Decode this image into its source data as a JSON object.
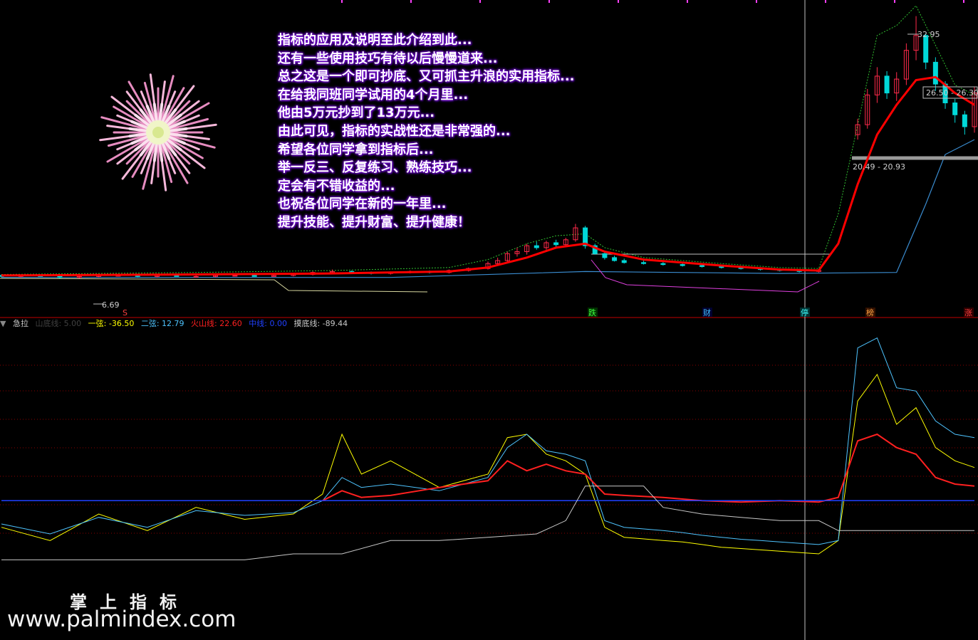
{
  "annotation_lines": [
    "指标的应用及说明至此介绍到此...",
    "还有一些使用技巧有待以后慢慢道来...",
    "总之这是一个即可抄底、又可抓主升浪的实用指标...",
    "在给我同班同学试用的4个月里...",
    "他由5万元抄到了13万元...",
    "由此可见，指标的实战性还是非常强的...",
    "希望各位同学拿到指标后...",
    "举一反三、反复练习、熟练技巧...",
    "定会有不错收益的...",
    "也祝各位同学在新的一年里...",
    "提升技能、提升财富、提升健康！"
  ],
  "legend": {
    "name": "急拉",
    "items": [
      {
        "label": "山底线: 5.00",
        "color": "#404040"
      },
      {
        "label": "一弦: -36.50",
        "color": "#ffff00"
      },
      {
        "label": "二弦: 12.79",
        "color": "#4ec4ff"
      },
      {
        "label": "火山线: 22.60",
        "color": "#ff2020"
      },
      {
        "label": "中线: 0.00",
        "color": "#2040ff"
      },
      {
        "label": "摸底线: -89.44",
        "color": "#c8c8c8"
      }
    ]
  },
  "watermark": {
    "line1": "掌上指标",
    "line2": "www.palmindex.com"
  },
  "colors": {
    "up": "#ff2a4a",
    "down": "#00d8d8",
    "ma": "#ff0000",
    "envelope": "#30c030",
    "lower_band": "#3a8cd0",
    "magenta": "#e040e0",
    "crosshair": "#c0c0c0",
    "grid": "#8a0000",
    "divider": "#c00000"
  },
  "chart_data": [
    {
      "type": "candlestick",
      "title": "",
      "price_labels": [
        "32.95",
        "26.50 - 26.30",
        "20.49 - 20.93",
        "6.69"
      ],
      "event_markers": [
        "S",
        "跌",
        "财",
        "停",
        "榜",
        "涨"
      ],
      "x_range": [
        0,
        100
      ],
      "y_range": [
        5,
        34
      ],
      "candles": [
        [
          0,
          6.8,
          6.9,
          6.6,
          6.7
        ],
        [
          2,
          6.7,
          6.9,
          6.6,
          6.8
        ],
        [
          4,
          6.8,
          6.9,
          6.7,
          6.7
        ],
        [
          6,
          6.7,
          6.8,
          6.5,
          6.6
        ],
        [
          8,
          6.6,
          6.8,
          6.5,
          6.7
        ],
        [
          10,
          6.7,
          6.9,
          6.6,
          6.8
        ],
        [
          12,
          6.8,
          6.9,
          6.7,
          6.8
        ],
        [
          14,
          6.8,
          6.8,
          6.6,
          6.7
        ],
        [
          16,
          6.7,
          6.8,
          6.6,
          6.8
        ],
        [
          18,
          6.8,
          6.9,
          6.7,
          6.7
        ],
        [
          20,
          6.7,
          6.8,
          6.6,
          6.7
        ],
        [
          22,
          6.7,
          6.9,
          6.6,
          6.8
        ],
        [
          24,
          6.8,
          6.9,
          6.7,
          6.8
        ],
        [
          26,
          6.8,
          6.9,
          6.7,
          6.7
        ],
        [
          28,
          6.7,
          6.9,
          6.7,
          6.8
        ],
        [
          30,
          6.8,
          7.0,
          6.7,
          6.9
        ],
        [
          32,
          6.9,
          7.2,
          6.8,
          7.1
        ],
        [
          34,
          7.1,
          7.4,
          7.0,
          7.2
        ],
        [
          36,
          7.2,
          7.3,
          7.0,
          7.1
        ],
        [
          38,
          7.1,
          7.2,
          6.9,
          7.0
        ],
        [
          40,
          7.0,
          7.2,
          6.9,
          7.1
        ],
        [
          42,
          7.1,
          7.3,
          7.0,
          7.2
        ],
        [
          44,
          7.2,
          7.3,
          7.0,
          7.1
        ],
        [
          46,
          7.1,
          7.4,
          7.0,
          7.3
        ],
        [
          48,
          7.3,
          7.6,
          7.2,
          7.5
        ],
        [
          50,
          7.5,
          8.2,
          7.4,
          8.0
        ],
        [
          51,
          8.0,
          8.6,
          7.8,
          8.3
        ],
        [
          52,
          8.3,
          9.2,
          8.1,
          9.0
        ],
        [
          53,
          9.0,
          9.6,
          8.7,
          9.2
        ],
        [
          54,
          9.2,
          10.0,
          8.9,
          9.8
        ],
        [
          55,
          9.8,
          10.2,
          9.4,
          9.6
        ],
        [
          56,
          9.6,
          10.3,
          9.4,
          10.1
        ],
        [
          57,
          10.1,
          10.4,
          9.7,
          9.9
        ],
        [
          58,
          9.9,
          10.6,
          9.7,
          10.4
        ],
        [
          59,
          10.4,
          12.0,
          10.2,
          11.6
        ],
        [
          60,
          11.6,
          11.8,
          9.5,
          9.8
        ],
        [
          61,
          9.8,
          10.0,
          8.9,
          9.0
        ],
        [
          62,
          9.0,
          9.2,
          8.4,
          8.6
        ],
        [
          63,
          8.6,
          8.8,
          8.2,
          8.3
        ],
        [
          64,
          8.3,
          8.5,
          8.0,
          8.1
        ],
        [
          66,
          8.1,
          8.3,
          7.9,
          8.0
        ],
        [
          68,
          8.0,
          8.2,
          7.8,
          7.9
        ],
        [
          70,
          7.9,
          8.1,
          7.7,
          7.8
        ],
        [
          72,
          7.8,
          8.0,
          7.6,
          7.7
        ],
        [
          74,
          7.7,
          7.8,
          7.5,
          7.6
        ],
        [
          76,
          7.6,
          7.7,
          7.4,
          7.5
        ],
        [
          78,
          7.5,
          7.6,
          7.3,
          7.4
        ],
        [
          80,
          7.4,
          7.5,
          7.2,
          7.3
        ],
        [
          82,
          7.3,
          7.4,
          7.1,
          7.2
        ],
        [
          84,
          7.2,
          7.4,
          7.1,
          7.3
        ],
        [
          88,
          21.0,
          22.6,
          20.5,
          22.0
        ],
        [
          89,
          22.0,
          25.6,
          21.6,
          25.0
        ],
        [
          90,
          25.0,
          27.8,
          24.2,
          26.9
        ],
        [
          91,
          26.9,
          27.4,
          24.6,
          25.2
        ],
        [
          92,
          25.2,
          27.3,
          24.4,
          26.6
        ],
        [
          93,
          26.6,
          30.2,
          26.0,
          29.5
        ],
        [
          94,
          29.5,
          32.95,
          28.5,
          31.0
        ],
        [
          95,
          31.0,
          31.2,
          27.6,
          28.3
        ],
        [
          96,
          28.3,
          28.8,
          25.4,
          26.1
        ],
        [
          97,
          26.1,
          26.4,
          23.6,
          24.2
        ],
        [
          98,
          24.2,
          24.6,
          22.2,
          23.0
        ],
        [
          99,
          23.0,
          23.4,
          21.0,
          21.8
        ],
        [
          100,
          21.8,
          25.8,
          21.2,
          25.2
        ]
      ],
      "ma_line": [
        [
          0,
          6.8
        ],
        [
          20,
          6.9
        ],
        [
          34,
          7.0
        ],
        [
          46,
          7.2
        ],
        [
          50,
          7.6
        ],
        [
          54,
          8.6
        ],
        [
          57,
          9.6
        ],
        [
          60,
          10.0
        ],
        [
          62,
          9.2
        ],
        [
          66,
          8.4
        ],
        [
          74,
          7.8
        ],
        [
          80,
          7.4
        ],
        [
          84,
          7.3
        ],
        [
          86,
          10.0
        ],
        [
          88,
          16.0
        ],
        [
          90,
          21.0
        ],
        [
          92,
          24.0
        ],
        [
          94,
          26.5
        ],
        [
          96,
          26.8
        ],
        [
          98,
          25.2
        ],
        [
          100,
          24.0
        ]
      ],
      "envelope_line": [
        [
          0,
          6.9
        ],
        [
          20,
          7.1
        ],
        [
          34,
          7.3
        ],
        [
          46,
          7.6
        ],
        [
          50,
          8.4
        ],
        [
          54,
          10.0
        ],
        [
          57,
          10.8
        ],
        [
          60,
          11.0
        ],
        [
          62,
          9.6
        ],
        [
          66,
          8.6
        ],
        [
          74,
          8.0
        ],
        [
          80,
          7.6
        ],
        [
          84,
          7.5
        ],
        [
          86,
          13.0
        ],
        [
          88,
          22.0
        ],
        [
          90,
          31.0
        ],
        [
          92,
          32.0
        ],
        [
          94,
          34.0
        ],
        [
          96,
          30.0
        ],
        [
          98,
          26.0
        ],
        [
          100,
          25.0
        ]
      ],
      "lower_band": [
        [
          0,
          6.6
        ],
        [
          40,
          6.6
        ],
        [
          60,
          7.2
        ],
        [
          80,
          7.0
        ],
        [
          92,
          7.1
        ],
        [
          95,
          14.0
        ],
        [
          97,
          19.0
        ],
        [
          100,
          20.5
        ]
      ]
    },
    {
      "type": "line",
      "title": "急拉",
      "x_range": [
        0,
        100
      ],
      "y_range": [
        -200,
        250
      ],
      "series": [
        {
          "name": "一弦",
          "color": "#ffff00",
          "x": [
            0,
            5,
            10,
            15,
            20,
            25,
            30,
            33,
            35,
            37,
            40,
            45,
            50,
            52,
            54,
            56,
            58,
            60,
            62,
            64,
            68,
            70,
            72,
            74,
            76,
            78,
            80,
            82,
            84,
            86,
            88,
            90,
            92,
            94,
            96,
            98,
            100
          ],
          "values": [
            -40,
            -60,
            -20,
            -45,
            -10,
            -28,
            -20,
            10,
            100,
            40,
            60,
            20,
            40,
            95,
            100,
            70,
            60,
            40,
            -40,
            -55,
            -60,
            -62,
            -66,
            -70,
            -72,
            -74,
            -76,
            -78,
            -80,
            -60,
            150,
            190,
            115,
            140,
            80,
            60,
            50
          ]
        },
        {
          "name": "二弦",
          "color": "#4ec4ff",
          "x": [
            0,
            5,
            10,
            15,
            20,
            25,
            30,
            33,
            35,
            37,
            40,
            45,
            50,
            52,
            54,
            56,
            58,
            60,
            62,
            64,
            68,
            70,
            72,
            74,
            76,
            78,
            80,
            82,
            84,
            86,
            88,
            90,
            92,
            94,
            96,
            98,
            100
          ],
          "values": [
            -35,
            -50,
            -25,
            -40,
            -15,
            -22,
            -18,
            0,
            35,
            20,
            25,
            15,
            35,
            80,
            100,
            75,
            70,
            60,
            -30,
            -40,
            -45,
            -48,
            -52,
            -55,
            -58,
            -60,
            -62,
            -64,
            -66,
            -60,
            230,
            245,
            170,
            165,
            120,
            100,
            95
          ]
        },
        {
          "name": "火山线",
          "color": "#ff2020",
          "x": [
            33,
            35,
            37,
            40,
            45,
            50,
            52,
            54,
            56,
            58,
            60,
            62,
            64,
            68,
            72,
            76,
            80,
            84,
            86,
            88,
            90,
            92,
            94,
            96,
            98,
            100
          ],
          "values": [
            0,
            15,
            5,
            8,
            20,
            30,
            60,
            45,
            55,
            45,
            40,
            10,
            8,
            5,
            0,
            -2,
            0,
            -2,
            5,
            90,
            100,
            80,
            70,
            35,
            25,
            22
          ]
        },
        {
          "name": "中线",
          "color": "#2040ff",
          "x": [
            0,
            100
          ],
          "values": [
            0,
            0
          ]
        },
        {
          "name": "摸底线",
          "color": "#c8c8c8",
          "x": [
            0,
            25,
            30,
            35,
            40,
            45,
            50,
            55,
            58,
            60,
            62,
            64,
            66,
            68,
            72,
            76,
            80,
            82,
            84,
            86,
            88,
            92,
            96,
            100
          ],
          "values": [
            -89,
            -89,
            -80,
            -80,
            -60,
            -60,
            -55,
            -50,
            -30,
            22,
            22,
            22,
            22,
            -10,
            -20,
            -25,
            -30,
            -30,
            -30,
            -45,
            -45,
            -45,
            -45,
            -45
          ]
        }
      ]
    }
  ]
}
